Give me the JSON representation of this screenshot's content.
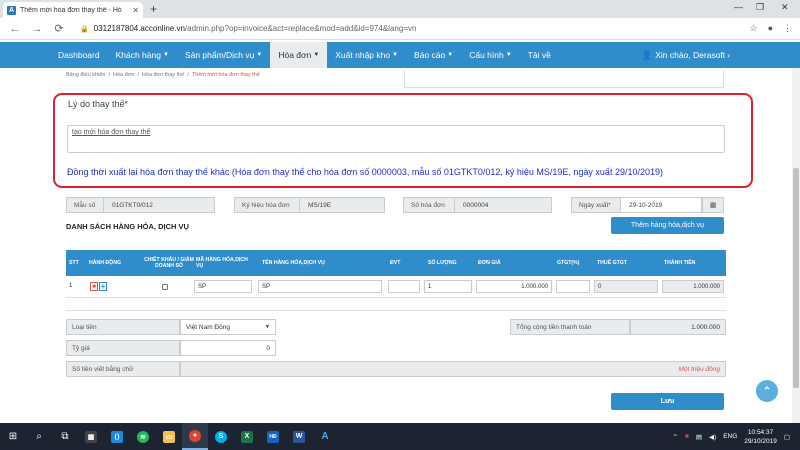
{
  "browser": {
    "tab_title": "Thêm mới hóa đơn thay thế - Hó",
    "url_host": "0312187804.acconline.vn",
    "url_path": "/admin.php?op=invoice&act=replace&mod=add&id=974&lang=vn"
  },
  "nav": {
    "items": [
      {
        "label": "Dashboard",
        "caret": false
      },
      {
        "label": "Khách hàng",
        "caret": true
      },
      {
        "label": "Sản phẩm/Dịch vụ",
        "caret": true
      },
      {
        "label": "Hóa đơn",
        "caret": true,
        "active": true
      },
      {
        "label": "Xuất nhập kho",
        "caret": true
      },
      {
        "label": "Báo cáo",
        "caret": true
      },
      {
        "label": "Cấu hình",
        "caret": true
      },
      {
        "label": "Tải về",
        "caret": false
      }
    ],
    "greeting": "Xin chào, Derasoft"
  },
  "breadcrumb": [
    "Bảng điều khiển",
    "Hóa đơn",
    "Hóa đơn thay thế",
    "Thêm mới hóa đơn thay thế"
  ],
  "reason": {
    "label": "Lý do thay thế*",
    "value": "tạo mới hóa đơn thay thế",
    "note": "Đồng thời xuất lại hóa đơn thay thế khác (Hóa đơn thay thế cho hóa đơn số 0000003, mẫu số 01GTKT0/012, ký hiệu MS/19E, ngày xuất 29/10/2019)"
  },
  "fields": {
    "mau_so_label": "Mẫu số",
    "mau_so_value": "01GTKT0/012",
    "ky_hieu_label": "Ký hiệu hóa đơn",
    "ky_hieu_value": "MS/19E",
    "so_hd_label": "Số hóa đơn",
    "so_hd_value": "0000004",
    "ngay_xuat_label": "Ngày xuất*",
    "ngay_xuat_value": "29-10-2019"
  },
  "goods": {
    "title": "DANH SÁCH HÀNG HÓA, DỊCH VỤ",
    "add_button": "Thêm hàng hóa,dịch vụ",
    "headers": [
      "STT",
      "HÀNH ĐỘNG",
      "CHIẾT KHẤU / GIẢM DOANH SỐ",
      "MÃ HÀNG HÓA,DỊCH VỤ",
      "TÊN HÀNG HÓA,DỊCH VỤ",
      "ĐVT",
      "SỐ LƯỢNG",
      "ĐƠN GIÁ",
      "GTGT(%)",
      "THUẾ GTGT",
      "THÀNH TIỀN"
    ],
    "row": {
      "stt": "1",
      "code": "SP",
      "name": "SP",
      "unit": "",
      "qty": "1",
      "price": "1.000.000",
      "vat_pct": "",
      "vat": "0",
      "total": "1.000.000"
    }
  },
  "summary": {
    "currency_label": "Loại tiền",
    "currency_value": "Việt Nam Đồng",
    "rate_label": "Tỷ giá",
    "rate_value": "0",
    "words_label": "Số tiền viết bằng chữ",
    "words_value": "Một triệu đồng",
    "total_label": "Tổng cộng tiền thanh toán",
    "total_value": "1.000.000",
    "save_button": "Lưu"
  },
  "taskbar": {
    "lang": "ENG",
    "time": "10:54:37",
    "date": "29/10/2019"
  },
  "colors": {
    "primary": "#2f8dcb",
    "highlight_border": "#d9232e",
    "note_text": "#1d2fd1",
    "words_text": "#d9534f"
  }
}
